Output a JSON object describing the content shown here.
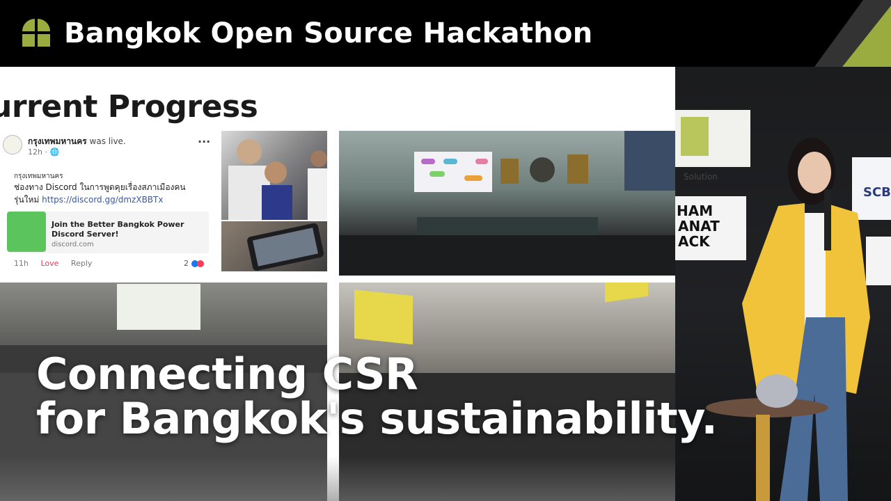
{
  "banner": {
    "title": "Bangkok Open Source Hackathon",
    "accent_color": "#9aab3f",
    "logo_icon": "quad-leaf-logo"
  },
  "slide": {
    "heading": "urrent Progress",
    "post": {
      "page_name": "กรุงเทพมหานคร",
      "live_text": " was live.",
      "time": "12h · 🌐",
      "menu": "···",
      "comment_author": "กรุงเทพมหานคร",
      "comment_line1": "ช่องทาง Discord ในการพูดคุยเรื่องสภาเมืองคน",
      "comment_line2_prefix": "รุ่นใหม่ ",
      "comment_link": "https://discord.gg/dmzXBBTx",
      "card_title_1": "Join the Better Bangkok Power",
      "card_title_2": "Discord Server!",
      "card_domain": "discord.com",
      "action_time": "11h",
      "action_love": "Love",
      "action_reply": "Reply",
      "reaction_count": "2"
    }
  },
  "headline": {
    "line1": "Connecting CSR",
    "line2": "for Bangkok's sustainability."
  },
  "camera": {
    "signs": [
      "Solution",
      "SCB",
      "HAM",
      "ANAT",
      "ACK"
    ]
  }
}
